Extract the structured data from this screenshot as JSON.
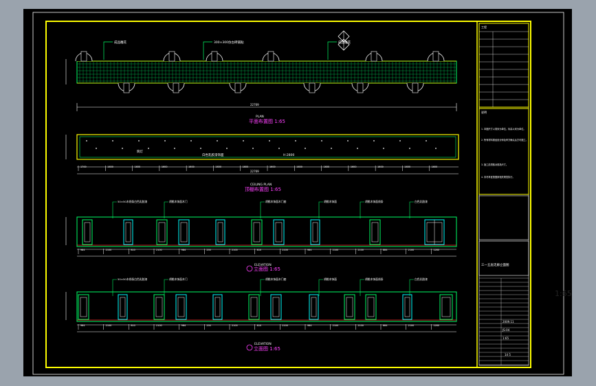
{
  "app": {
    "zoom_readout": "1:65"
  },
  "colors": {
    "background": "#9aa3ad",
    "canvas": "#000000",
    "frame": "#ffff00",
    "lines": "#00ff66",
    "doors": "#00ffff",
    "dimension": "#ffffff",
    "titles": "#ff40ff"
  },
  "drawing": {
    "plan": {
      "title": "平面布置图 1:65",
      "caption": "PLAN",
      "notes": [
        "成品雕花",
        "300×300仿古砖铺贴",
        "成品雕花"
      ],
      "total_dim": "22769"
    },
    "ceiling": {
      "title": "顶棚布置图 1:65",
      "caption": "CEILING PLAN",
      "notes": [
        "筒灯",
        "白色乳胶漆饰面",
        "H:2800"
      ],
      "dims": [
        "1700",
        "1600",
        "1600",
        "1600",
        "1600",
        "1600",
        "1600",
        "1600",
        "1600",
        "1600",
        "1600",
        "1600",
        "1600",
        "1600"
      ],
      "total_dim": "22769"
    },
    "elevation1": {
      "title": "立面图 1:65",
      "caption": "ELEVATION",
      "notes": [
        "50×50木线条白色乳胶漆",
        "胡桃木饰面木门",
        "胡桃木饰面木门套",
        "胡桃木饰面",
        "胡桃木饰面线条",
        "白色乳胶漆"
      ],
      "dims": [
        "984",
        "2100",
        "810",
        "2100",
        "984",
        "250",
        "2100",
        "810",
        "2100",
        "984",
        "2100",
        "2100",
        "884",
        "2100",
        "1280"
      ]
    },
    "elevation2": {
      "title": "立面图 1:65",
      "caption": "ELEVATION",
      "notes": [
        "50×50木线条白色乳胶漆",
        "胡桃木饰面木门",
        "胡桃木饰面木门套",
        "胡桃木饰面",
        "胡桃木饰面线条",
        "白色乳胶漆"
      ],
      "dims": [
        "984",
        "2100",
        "810",
        "2100",
        "984",
        "250",
        "2100",
        "810",
        "2100",
        "984",
        "2100",
        "2100",
        "884",
        "2100",
        "1280"
      ]
    },
    "title_block": {
      "project_label": "工程",
      "notes_label": "说明",
      "notes": [
        "1. 本图尺寸以毫米为单位，标高以米为单位。",
        "2. 所有材料需经设计师及甲方确认后方可施工。",
        "3. 施工前须核对现场尺寸。",
        "4. 未尽事宜按国家相关规范执行。"
      ],
      "drawing_name": "三一五层走廊立面图",
      "scale_value": "1:65",
      "date_value": "2009.11",
      "sheet_no": "JS-04",
      "page_no": "14 5"
    }
  }
}
